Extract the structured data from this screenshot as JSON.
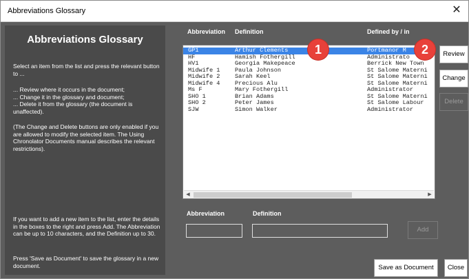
{
  "window": {
    "title": "Abbreviations Glossary",
    "close_glyph": "✕"
  },
  "left_panel": {
    "heading": "Abbreviations Glossary",
    "intro": "Select an item from the list and press the relevant button to ...",
    "actions": "... Review where it occurs in the document;\n... Change it in the glossary and document;\n... Delete it from the glossary (the document is\n    unaffected).",
    "note": "(The Change and Delete buttons are only enabled if you are allowed to modify the selected item. The Using Chronolator Documents manual describes the relevant restrictions).",
    "add_help": "If you want to add a new item to the list, enter the details in the boxes to the right and press Add. The Abbreviation can be up to 10 characters, and the Definition up to 30.",
    "save_help": "Press 'Save as Document' to save the glossary in a new document."
  },
  "list": {
    "headers": {
      "abbreviation": "Abbreviation",
      "definition": "Definition",
      "defined_by": "Defined by / in"
    },
    "rows": [
      {
        "abbr": "GP1",
        "def": "Arthur Clements",
        "by": "Portmanor M",
        "selected": true
      },
      {
        "abbr": "HF",
        "def": "Hamish Fothergill",
        "by": "Administrato",
        "selected": false
      },
      {
        "abbr": "HV1",
        "def": "Georgia Makepeace",
        "by": "Berrick New Town",
        "selected": false
      },
      {
        "abbr": "Midwife 1",
        "def": "Paula Johnson",
        "by": "St Salome Materni",
        "selected": false
      },
      {
        "abbr": "Midwife 2",
        "def": "Sarah Keel",
        "by": "St Salome Materni",
        "selected": false
      },
      {
        "abbr": "Midwife 4",
        "def": "Precious Alu",
        "by": "St Salome Materni",
        "selected": false
      },
      {
        "abbr": "Ms F",
        "def": "Mary Fothergill",
        "by": "Administrator",
        "selected": false
      },
      {
        "abbr": "SHO 1",
        "def": "Brian Adams",
        "by": "St Salome Materni",
        "selected": false
      },
      {
        "abbr": "SHO 2",
        "def": "Peter James",
        "by": "St Salome Labour",
        "selected": false
      },
      {
        "abbr": "SJW",
        "def": "Simon Walker",
        "by": "Administrator",
        "selected": false
      }
    ],
    "scroll_left_glyph": "◀",
    "scroll_right_glyph": "▶"
  },
  "badges": [
    "1",
    "2"
  ],
  "buttons": {
    "review": "Review",
    "change": "Change",
    "delete": "Delete",
    "add": "Add",
    "save_as_document": "Save as Document",
    "close": "Close"
  },
  "inputs": {
    "abbreviation_label": "Abbreviation",
    "definition_label": "Definition",
    "abbreviation_value": "",
    "definition_value": ""
  },
  "colors": {
    "selection": "#3b84e6",
    "badge": "#e8413a",
    "panel": "#4a4a4a",
    "background": "#5d5d5d"
  }
}
